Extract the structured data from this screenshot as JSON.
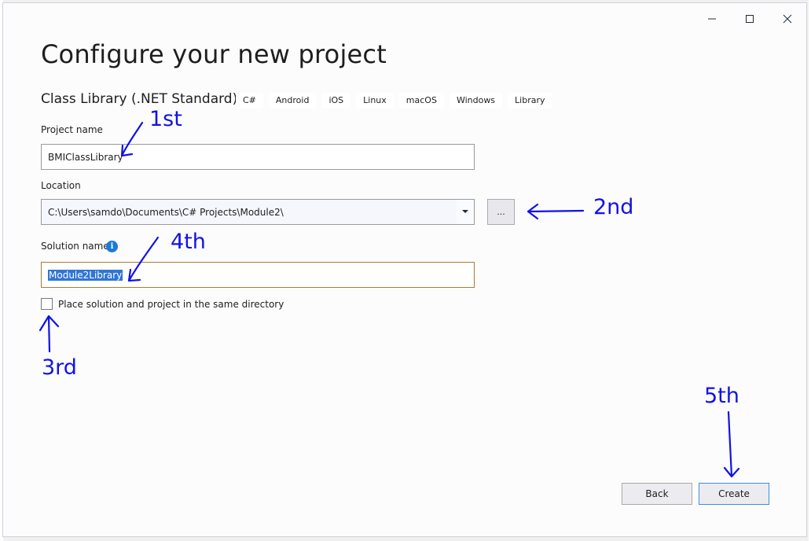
{
  "window": {
    "title": "Configure your new project",
    "controls": {
      "minimize": "minimize-icon",
      "maximize": "maximize-icon",
      "close": "close-icon"
    }
  },
  "template": {
    "name": "Class Library (.NET Standard)",
    "tags": [
      "C#",
      "Android",
      "iOS",
      "Linux",
      "macOS",
      "Windows",
      "Library"
    ]
  },
  "form": {
    "project_name": {
      "label": "Project name",
      "value": "BMIClassLibrary"
    },
    "location": {
      "label": "Location",
      "value": "C:\\Users\\samdo\\Documents\\C# Projects\\Module2\\",
      "browse_label": "..."
    },
    "solution_name": {
      "label": "Solution name",
      "value": "Module2Library",
      "info_icon": "info-icon"
    },
    "same_directory": {
      "label": "Place solution and project in the same directory",
      "checked": false
    }
  },
  "buttons": {
    "back": "Back",
    "create": "Create"
  },
  "annotations": {
    "step1": "1st",
    "step2": "2nd",
    "step3": "3rd",
    "step4": "4th",
    "step5": "5th",
    "color": "#1212e6"
  }
}
